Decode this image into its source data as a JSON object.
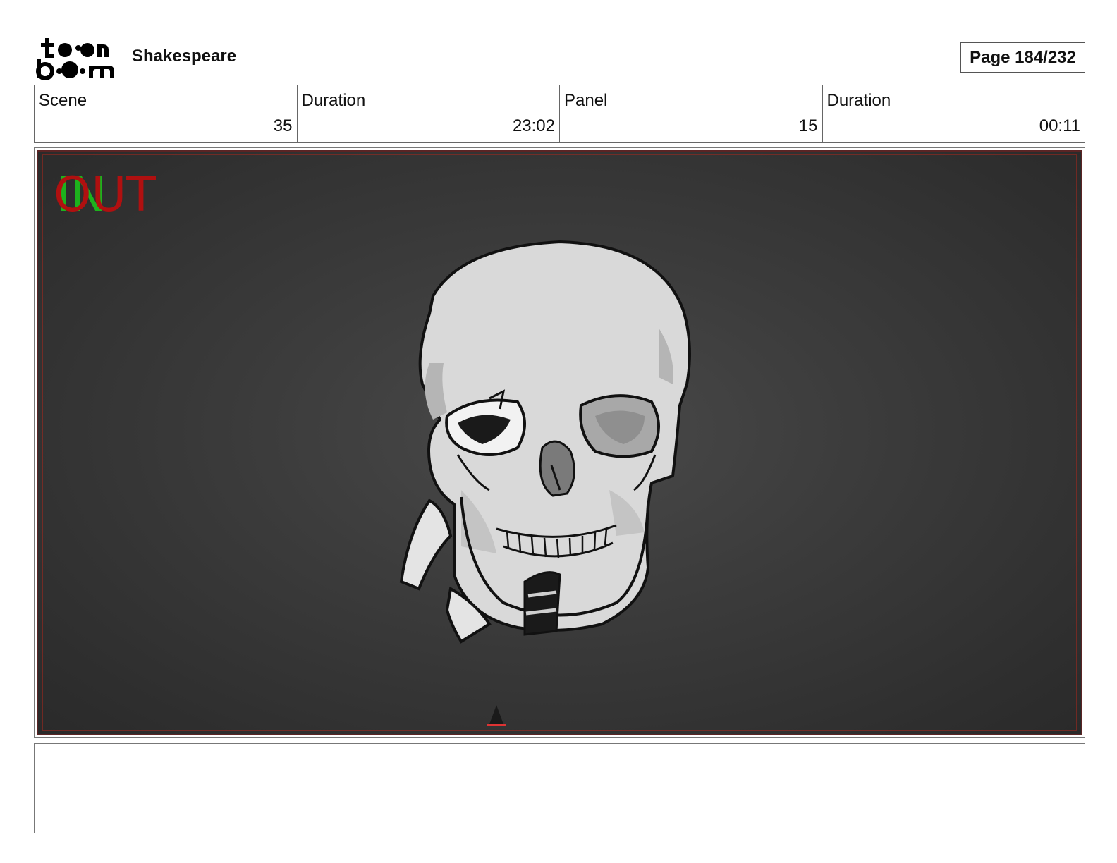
{
  "header": {
    "logo_line1": "t••n",
    "logo_line2": "b••m",
    "project_title": "Shakespeare",
    "page_indicator": "Page 184/232"
  },
  "info": {
    "scene_label": "Scene",
    "scene_value": "35",
    "scene_duration_label": "Duration",
    "scene_duration_value": "23:02",
    "panel_label": "Panel",
    "panel_value": "15",
    "panel_duration_label": "Duration",
    "panel_duration_value": "00:11"
  },
  "panel": {
    "marker_in": "IN",
    "marker_out": "OUT",
    "colors": {
      "in": "#1db21d",
      "out": "#b01010",
      "background": "#3c3c3c"
    }
  },
  "notes": {
    "text": ""
  }
}
